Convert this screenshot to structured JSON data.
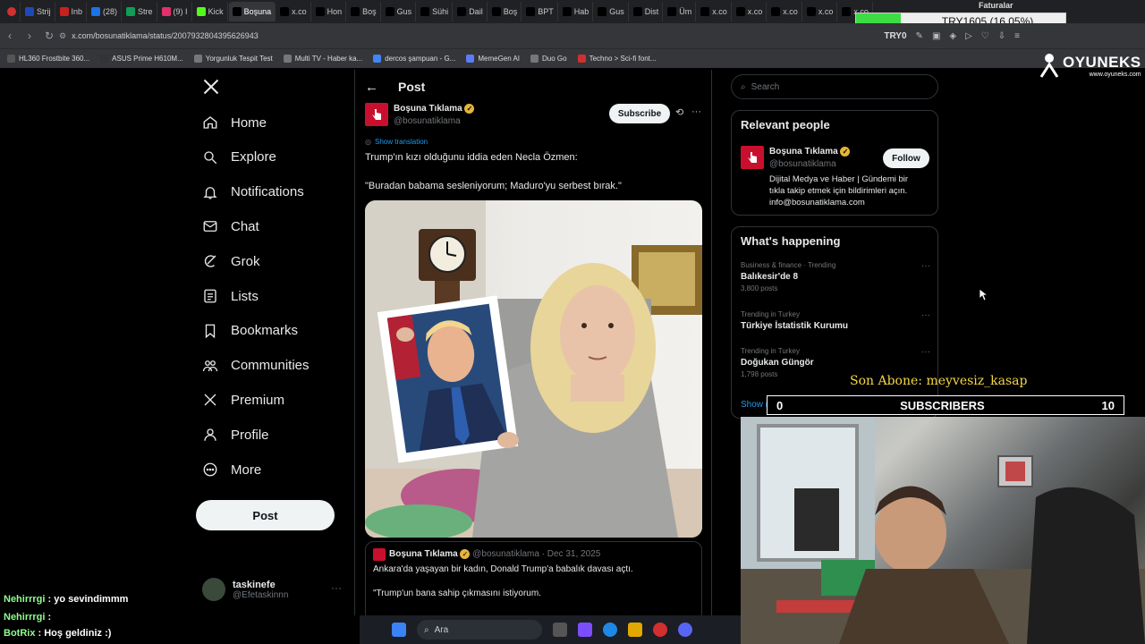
{
  "browser": {
    "tabs": [
      {
        "label": "Strij",
        "color": "#1e4ab8"
      },
      {
        "label": "Inb",
        "color": "#c5221f"
      },
      {
        "label": "(28)",
        "color": "#1a73e8"
      },
      {
        "label": "Stre",
        "color": "#0f9d58"
      },
      {
        "label": "(9) I",
        "color": "#e1306c"
      },
      {
        "label": "Kick",
        "color": "#53fc18"
      },
      {
        "label": "Boşuna",
        "color": "#000000"
      },
      {
        "label": "x.co",
        "color": "#000000"
      },
      {
        "label": "Hon",
        "color": "#000000"
      },
      {
        "label": "Boş",
        "color": "#000000"
      },
      {
        "label": "Gus",
        "color": "#000000"
      },
      {
        "label": "Sühi",
        "color": "#000000"
      },
      {
        "label": "Dail",
        "color": "#000000"
      },
      {
        "label": "Boş",
        "color": "#000000"
      },
      {
        "label": "BPT",
        "color": "#000000"
      },
      {
        "label": "Hab",
        "color": "#000000"
      },
      {
        "label": "Gus",
        "color": "#000000"
      },
      {
        "label": "Dist",
        "color": "#000000"
      },
      {
        "label": "Üm",
        "color": "#000000"
      },
      {
        "label": "x.co",
        "color": "#000000"
      },
      {
        "label": "x.co",
        "color": "#000000"
      },
      {
        "label": "x.co",
        "color": "#000000"
      },
      {
        "label": "x.co",
        "color": "#000000"
      },
      {
        "label": "x.co",
        "color": "#000000"
      }
    ],
    "url": "x.com/bosunatiklama/status/2007932804395626943",
    "ext_label": "TRY0",
    "bookmarks": [
      {
        "label": "HL360 Frostbite 360...",
        "color": "#555555"
      },
      {
        "label": "ASUS Prime H610M...",
        "color": "#333333"
      },
      {
        "label": "Yorgunluk Tespit Test",
        "color": "#777777"
      },
      {
        "label": "Multi TV - Haber ka...",
        "color": "#777777"
      },
      {
        "label": "dercos şampuan - G...",
        "color": "#4285f4"
      },
      {
        "label": "MemeGen AI",
        "color": "#5b7cf7"
      },
      {
        "label": "Duo Go",
        "color": "#777777"
      },
      {
        "label": "Techno > Sci-fi font...",
        "color": "#d32f2f"
      }
    ]
  },
  "overlay": {
    "faturalar": "Faturalar",
    "currency_text": "TRY1605 (16.05%)",
    "currency_fraction": 0.1605,
    "brand": "OYUNEKS",
    "brand_url": "www.oyuneks.com",
    "son_abone": "Son Abone: meyvesiz_kasap",
    "subs_left": "0",
    "subs_label": "SUBSCRIBERS",
    "subs_right": "10"
  },
  "sidebar": {
    "items": [
      {
        "label": "Home",
        "icon": "home-icon"
      },
      {
        "label": "Explore",
        "icon": "search-icon"
      },
      {
        "label": "Notifications",
        "icon": "bell-icon"
      },
      {
        "label": "Chat",
        "icon": "mail-icon"
      },
      {
        "label": "Grok",
        "icon": "grok-icon"
      },
      {
        "label": "Lists",
        "icon": "list-icon"
      },
      {
        "label": "Bookmarks",
        "icon": "bookmark-icon"
      },
      {
        "label": "Communities",
        "icon": "people-icon"
      },
      {
        "label": "Premium",
        "icon": "x-logo-icon"
      },
      {
        "label": "Profile",
        "icon": "person-icon"
      },
      {
        "label": "More",
        "icon": "more-circle-icon"
      }
    ],
    "post_button": "Post",
    "account_name": "taskinefe",
    "account_handle": "@Efetaskinnn"
  },
  "post": {
    "header": "Post",
    "author": "Boşuna Tıklama",
    "handle": "@bosunatiklama",
    "subscribe": "Subscribe",
    "show_translation": "Show translation",
    "text_line1": "Trump'ın kızı olduğunu iddia eden Necla Özmen:",
    "text_line2": "\"Buradan babama sesleniyorum; Maduro'yu serbest bırak.\"",
    "quote_author": "Boşuna Tıklama",
    "quote_handle": "@bosunatiklama",
    "quote_date": "· Dec 31, 2025",
    "quote_line1": "Ankara'da yaşayan bir kadın, Donald Trump'a babalık davası açtı.",
    "quote_line2": "\"Trump'un bana sahip çıkmasını istiyorum."
  },
  "right": {
    "search_placeholder": "Search",
    "relevant_title": "Relevant people",
    "person_name": "Boşuna Tıklama",
    "person_handle": "@bosunatiklama",
    "follow": "Follow",
    "person_bio_1": "Dijital Medya ve Haber | Gündemi bir",
    "person_bio_2": "tıkla takip etmek için bildirimleri açın.",
    "person_bio_3": "info@bosunatiklama.com",
    "happening_title": "What's happening",
    "trends": [
      {
        "meta": "Business & finance · Trending",
        "name": "Balıkesir'de 8",
        "posts": "3,800 posts"
      },
      {
        "meta": "Trending in Turkey",
        "name": "Türkiye İstatistik Kurumu",
        "posts": ""
      },
      {
        "meta": "Trending in Turkey",
        "name": "Doğukan Güngör",
        "posts": "1,798 posts"
      }
    ],
    "show_more": "Show more"
  },
  "chat": [
    {
      "user": "Nehirrrgi",
      "msg": ": yo sevindimmm"
    },
    {
      "user": "Nehirrrgi",
      "msg": ":"
    },
    {
      "user": "BotRix",
      "msg": ": Hoş geldiniz :)"
    }
  ],
  "taskbar": {
    "search_label": "Ara"
  }
}
